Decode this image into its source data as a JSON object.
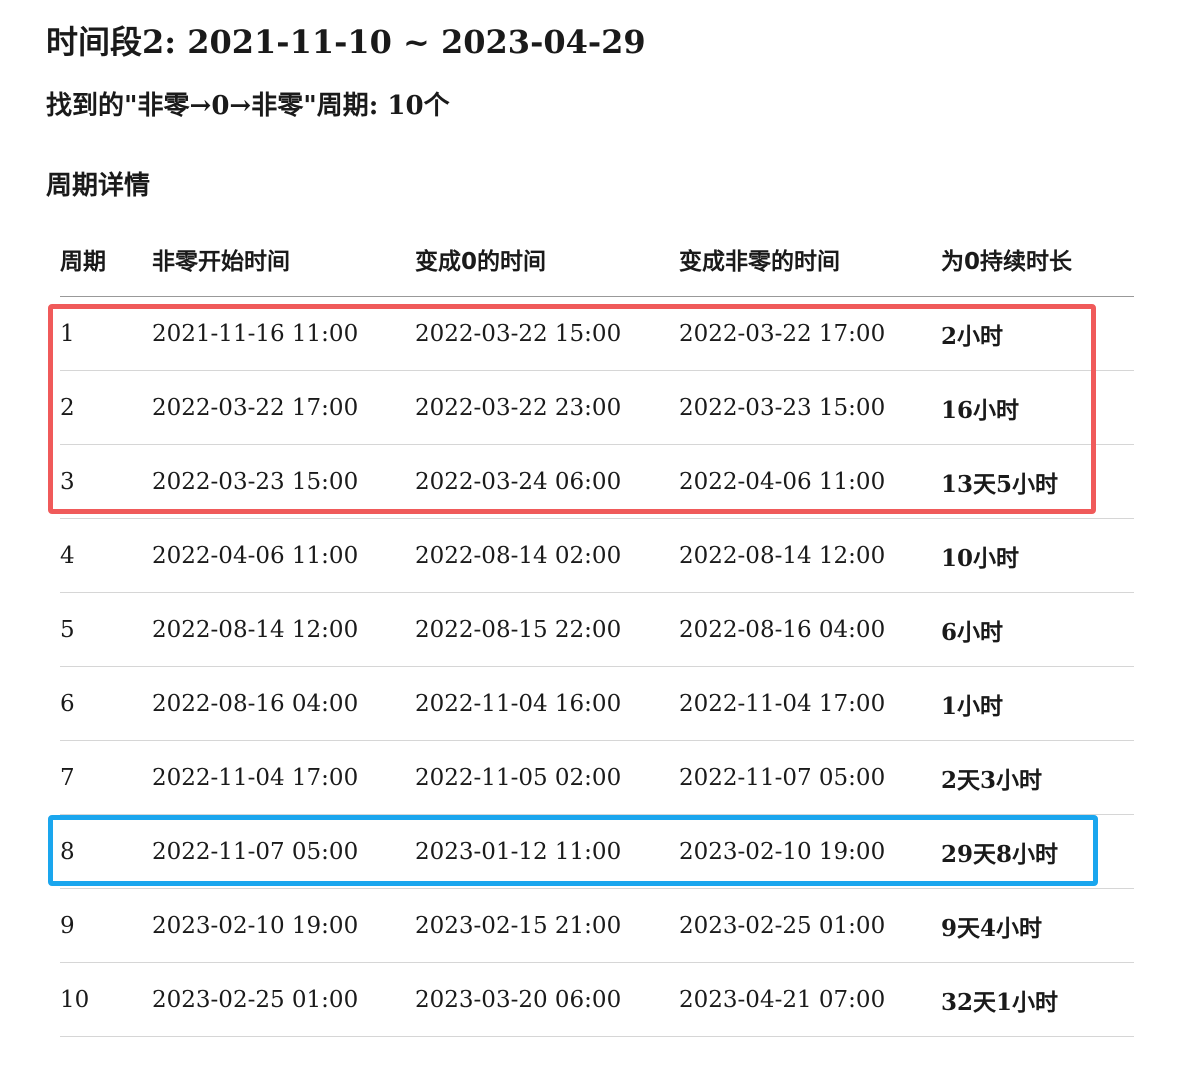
{
  "title": "时间段2: 2021-11-10 ~ 2023-04-29",
  "subtitle": "找到的\"非零→0→非零\"周期: 10个",
  "section_title": "周期详情",
  "table": {
    "headers": [
      "周期",
      "非零开始时间",
      "变成0的时间",
      "变成非零的时间",
      "为0持续时长"
    ],
    "rows": [
      [
        "1",
        "2021-11-16 11:00",
        "2022-03-22 15:00",
        "2022-03-22 17:00",
        "2小时"
      ],
      [
        "2",
        "2022-03-22 17:00",
        "2022-03-22 23:00",
        "2022-03-23 15:00",
        "16小时"
      ],
      [
        "3",
        "2022-03-23 15:00",
        "2022-03-24 06:00",
        "2022-04-06 11:00",
        "13天5小时"
      ],
      [
        "4",
        "2022-04-06 11:00",
        "2022-08-14 02:00",
        "2022-08-14 12:00",
        "10小时"
      ],
      [
        "5",
        "2022-08-14 12:00",
        "2022-08-15 22:00",
        "2022-08-16 04:00",
        "6小时"
      ],
      [
        "6",
        "2022-08-16 04:00",
        "2022-11-04 16:00",
        "2022-11-04 17:00",
        "1小时"
      ],
      [
        "7",
        "2022-11-04 17:00",
        "2022-11-05 02:00",
        "2022-11-07 05:00",
        "2天3小时"
      ],
      [
        "8",
        "2022-11-07 05:00",
        "2023-01-12 11:00",
        "2023-02-10 19:00",
        "29天8小时"
      ],
      [
        "9",
        "2023-02-10 19:00",
        "2023-02-15 21:00",
        "2023-02-25 01:00",
        "9天4小时"
      ],
      [
        "10",
        "2023-02-25 01:00",
        "2023-03-20 06:00",
        "2023-04-21 07:00",
        "32天1小时"
      ]
    ]
  },
  "highlights": {
    "red_color": "#f05a5a",
    "blue_color": "#1aa6ee"
  }
}
